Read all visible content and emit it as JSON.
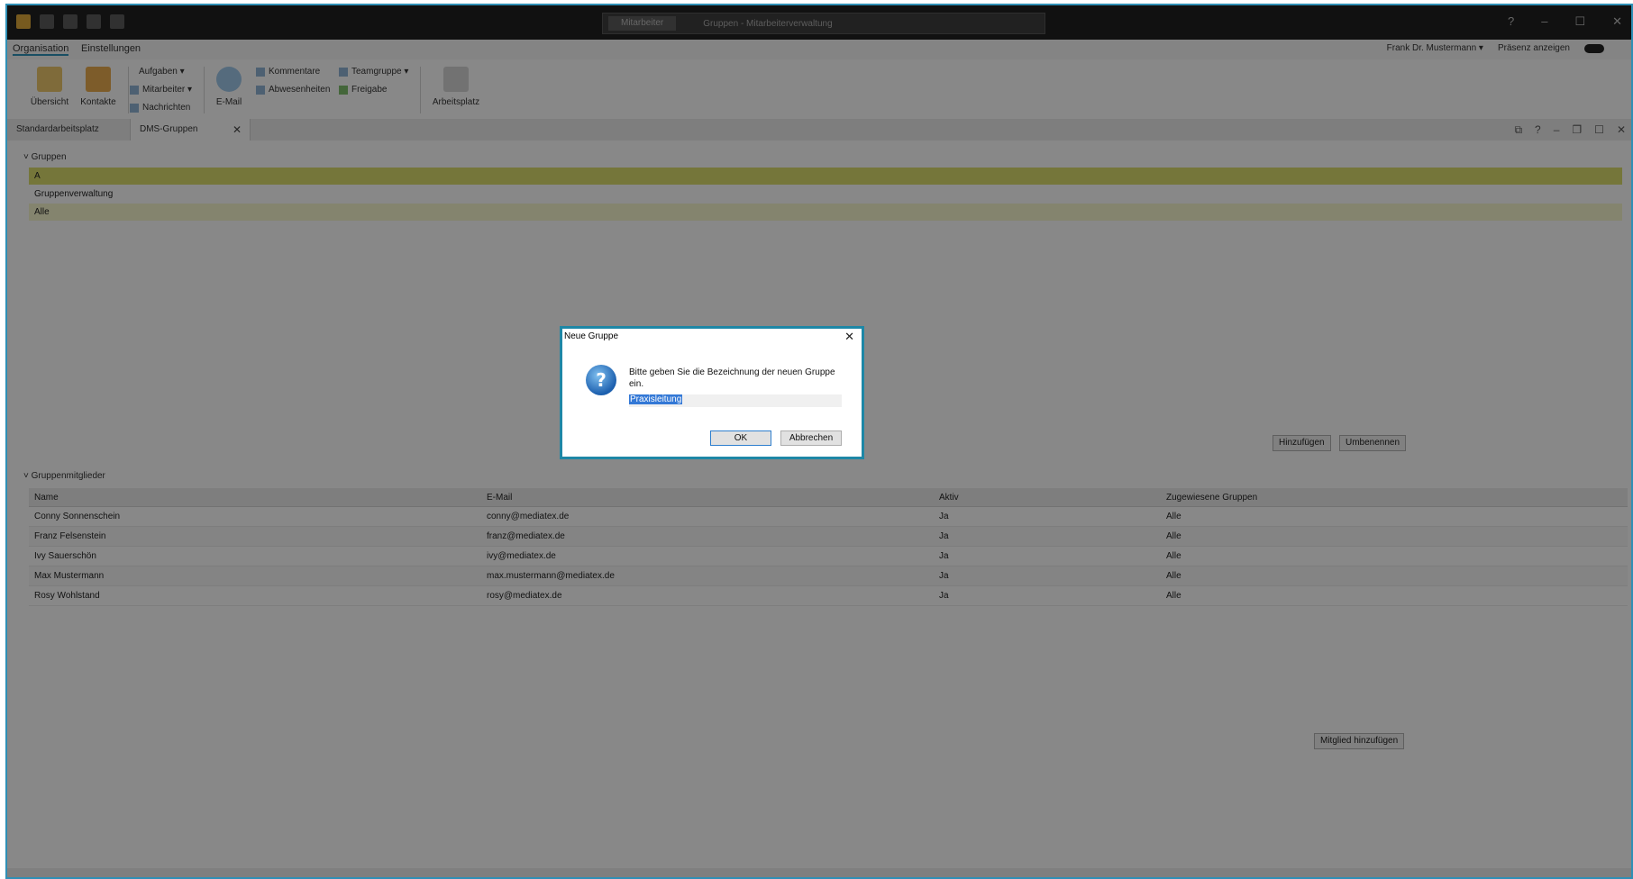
{
  "titlebar": {
    "pill": "Mitarbeiter",
    "title": "Gruppen - Mitarbeiterverwaltung"
  },
  "ribbon_tabs": [
    "Organisation",
    "Einstellungen"
  ],
  "user": {
    "name": "Frank Dr. Mustermann ▾",
    "presence": "Präsenz anzeigen"
  },
  "ribbon": {
    "big_buttons": [
      "Übersicht",
      "Kontakte",
      "E-Mail",
      "Arbeitsplatz"
    ],
    "small_buttons": [
      "Aufgaben ▾",
      "Mitarbeiter ▾",
      "Nachrichten",
      "Kommentare",
      "Abwesenheiten",
      "Teamgruppe ▾",
      "Freigabe"
    ]
  },
  "doc_tabs": [
    "Standardarbeitsplatz",
    "DMS-Gruppen"
  ],
  "groups": {
    "section_title": "Gruppen",
    "rows": [
      "A",
      "Gruppenverwaltung",
      "Alle"
    ]
  },
  "group_buttons": {
    "add": "Hinzufügen",
    "rename": "Umbenennen"
  },
  "members": {
    "section_title": "Gruppenmitglieder",
    "columns": [
      "Name",
      "E-Mail",
      "Aktiv",
      "Zugewiesene Gruppen"
    ],
    "rows": [
      [
        "Conny Sonnenschein",
        "conny@mediatex.de",
        "Ja",
        "Alle"
      ],
      [
        "Franz Felsenstein",
        "franz@mediatex.de",
        "Ja",
        "Alle"
      ],
      [
        "Ivy Sauerschön",
        "ivy@mediatex.de",
        "Ja",
        "Alle"
      ],
      [
        "Max Mustermann",
        "max.mustermann@mediatex.de",
        "Ja",
        "Alle"
      ],
      [
        "Rosy Wohlstand",
        "rosy@mediatex.de",
        "Ja",
        "Alle"
      ]
    ],
    "add_member_button": "Mitglied hinzufügen"
  },
  "dialog": {
    "title": "Neue Gruppe",
    "close": "✕",
    "icon": "question-icon",
    "icon_glyph": "?",
    "message": "Bitte geben Sie die Bezeichnung der neuen Gruppe ein.",
    "input_value": "Praxisleitung",
    "ok_label": "OK",
    "cancel_label": "Abbrechen"
  }
}
